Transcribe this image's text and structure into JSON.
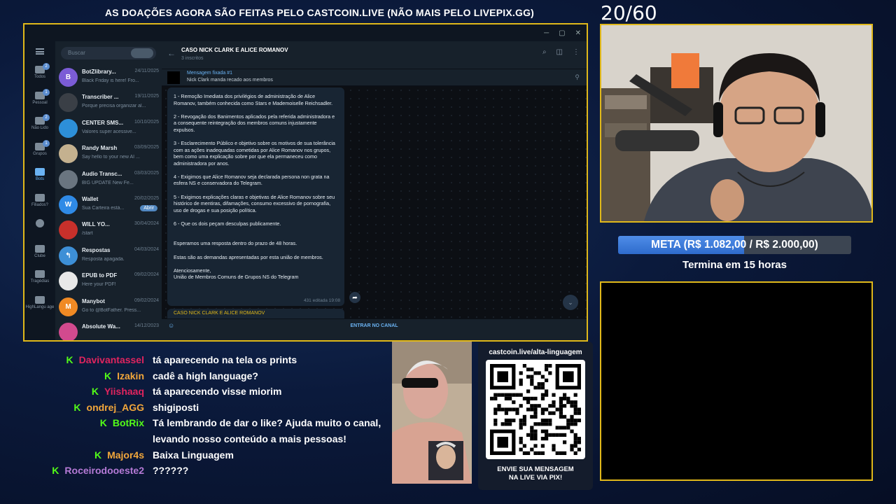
{
  "banner": "AS DOAÇÕES AGORA SÃO FEITAS PELO CASTCOIN.LIVE (NÃO MAIS PELO LIVEPIX.GG)",
  "counter": "20/60",
  "telegram": {
    "rail": [
      {
        "label": "Todos",
        "badge": "2"
      },
      {
        "label": "Pessoal",
        "badge": "1"
      },
      {
        "label": "Não Lido",
        "badge": "2"
      },
      {
        "label": "Grupos",
        "badge": "1"
      },
      {
        "label": "Bots",
        "badge": ""
      },
      {
        "label": "Filiados?",
        "badge": ""
      },
      {
        "label": "",
        "badge": ""
      },
      {
        "label": "Clube",
        "badge": ""
      },
      {
        "label": "Tragédias",
        "badge": ""
      },
      {
        "label": "HighLangu age",
        "badge": ""
      }
    ],
    "search_placeholder": "Buscar",
    "chats": [
      {
        "name": "BotZlibrary...",
        "date": "24/11/2025",
        "preview": "Black Friday is here! Fro...",
        "color": "#7b5cd6",
        "letter": "B"
      },
      {
        "name": "Transcriber ...",
        "date": "19/11/2025",
        "preview": "Porque precisa organizar al...",
        "color": "#3a3f46",
        "letter": ""
      },
      {
        "name": "CENTER SMS...",
        "date": "10/10/2025",
        "preview": "Valores super acessive...",
        "color": "#2d8fd8",
        "letter": ""
      },
      {
        "name": "Randy Marsh",
        "date": "03/09/2025",
        "preview": "Say hello to your new AI ...",
        "color": "#c4b18f",
        "letter": ""
      },
      {
        "name": "Audio Transc...",
        "date": "03/03/2025",
        "preview": "BIG UPDATE New Fe...",
        "color": "#6a7580",
        "letter": ""
      },
      {
        "name": "Wallet",
        "date": "20/02/2025",
        "preview": "Sua Carteira está...",
        "color": "#2f8ae6",
        "letter": "W",
        "action": "Abrir"
      },
      {
        "name": "WILL YO...",
        "date": "30/04/2024",
        "preview": "/start",
        "color": "#c7302b",
        "letter": ""
      },
      {
        "name": "Respostas",
        "date": "04/03/2024",
        "preview": "Resposta apagada.",
        "color": "#3d8fd6",
        "letter": "↰"
      },
      {
        "name": "EPUB to PDF",
        "date": "09/02/2024",
        "preview": "Here your PDF!",
        "color": "#e8e8e8",
        "letter": ""
      },
      {
        "name": "Manybot",
        "date": "09/02/2024",
        "preview": "Go to @BotFather. Press...",
        "color": "#f08a24",
        "letter": "M"
      },
      {
        "name": "Absolute Wa...",
        "date": "14/12/2023",
        "preview": "",
        "color": "#d24a8e",
        "letter": ""
      }
    ],
    "header": {
      "title": "CASO NICK CLARK E ALICE ROMANOV",
      "subtitle": "3 inscritos"
    },
    "pinned": {
      "title": "Mensagem fixada #1",
      "body": "Nick Clark manda recado aos membros"
    },
    "message": {
      "paragraphs": [
        "1 - Remoção Imediata dos privilégios de administração de Alice Romanov, também conhecida como Stars e Mademoiselle Reichsadler.",
        "2 - Revogação dos Banimentos aplicados pela referida administradora e a consequente reintegração dos membros comuns injustamente expulsos.",
        "3 - Esclarecimento Público e objetivo sobre os motivos de sua tolerância com as ações inadequadas cometidas por Alice Romanov nos grupos, bem como uma explicação sobre por que ela permaneceu como administradora por anos.",
        "4 - Exigimos que Alice Romanov seja declarada persona non grata na esfera NS e conservadora do Telegram.",
        "5 - Exigimos explicações claras e objetivas de Alice Romanov sobre seu histórico de mentiras, difamações, consumo excessivo de pornografia, uso de drogas e sua posição política.",
        "6 - Que os dois peçam desculpas publicamente.",
        "Esperamos uma resposta dentro do prazo de 48 horas.",
        "Estas são as demandas apresentadas por esta união de membros.",
        "Atenciosamente,\nUnião de Membros Comuns de Grupos NS do Telegram"
      ],
      "meta": "431   editada 19:08"
    },
    "next_message": "CASO NICK CLARK E ALICE ROMANOV",
    "join_label": "ENTRAR NO CANAL"
  },
  "goal": {
    "text": "META (R$ 1.082,00 / R$ 2.000,00)",
    "progress": 0.541,
    "subtext": "Termina em 15 horas"
  },
  "chat": [
    {
      "user": "Davivantassel",
      "color": "#e0245e",
      "text": "tá aparecendo na tela os prints"
    },
    {
      "user": "Izakin",
      "color": "#f2a73b",
      "text": "cadê a high language?"
    },
    {
      "user": "Yiishaaq",
      "color": "#e0245e",
      "text": "tá aparecendo visse miorim"
    },
    {
      "user": "ondrej_AGG",
      "color": "#f2a73b",
      "text": "shigiposti"
    },
    {
      "user": "BotRix",
      "color": "#53fc18",
      "text": "Tá lembrando de dar o like? Ajuda muito o canal,"
    },
    {
      "user": "",
      "color": "#ffffff",
      "text": "levando nosso conteúdo a mais pessoas!"
    },
    {
      "user": "Major4s",
      "color": "#f2a73b",
      "text": "Baixa Linguagem"
    },
    {
      "user": "Roceirodooeste2",
      "color": "#b57ad6",
      "text": "??????"
    }
  ],
  "qr": {
    "url": "castcoin.live/alta-linguagem",
    "line1": "ENVIE SUA MENSAGEM",
    "line2": "NA LIVE VIA PIX!"
  },
  "colors": {
    "accent": "#e0b81a",
    "kick_green": "#53fc18",
    "telegram_blue": "#6ab2f2"
  }
}
